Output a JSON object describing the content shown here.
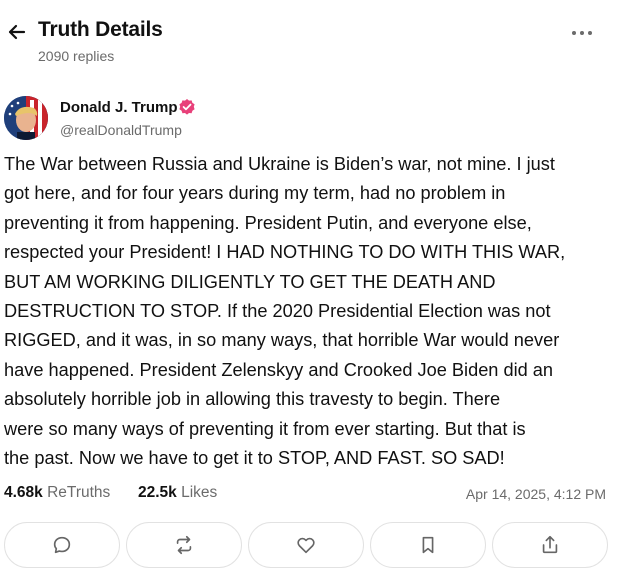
{
  "header": {
    "title": "Truth Details",
    "replies": "2090 replies",
    "back_icon": "arrow-left-icon",
    "more_icon": "more-horizontal-icon"
  },
  "author": {
    "display_name": "Donald J. Trump",
    "handle": "@realDonaldTrump",
    "verified_color": "#e8417a",
    "verified_icon": "verified-badge-icon"
  },
  "post": {
    "text": "The War between Russia and Ukraine is Biden’s war, not mine. I just\ngot here, and for four years during my term, had no problem in\npreventing it from happening. President Putin, and everyone else,\nrespected your President! I HAD NOTHING TO DO WITH THIS WAR,\nBUT AM WORKING DILIGENTLY TO GET THE DEATH AND\nDESTRUCTION TO STOP. If the 2020 Presidential Election was not\nRIGGED, and it was, in so many ways, that horrible War would never\nhave happened. President Zelenskyy and Crooked Joe Biden did an\nabsolutely horrible job in allowing this travesty to begin. There\nwere so many ways of preventing it from ever starting. But that is\nthe past. Now we have to get it to STOP, AND FAST. SO SAD!"
  },
  "stats": {
    "retruths_count": "4.68k",
    "retruths_label": "ReTruths",
    "likes_count": "22.5k",
    "likes_label": "Likes",
    "timestamp": "Apr 14, 2025, 4:12 PM"
  },
  "actions": [
    {
      "icon": "reply-icon"
    },
    {
      "icon": "retruth-icon"
    },
    {
      "icon": "like-icon"
    },
    {
      "icon": "bookmark-icon"
    },
    {
      "icon": "share-icon"
    }
  ]
}
